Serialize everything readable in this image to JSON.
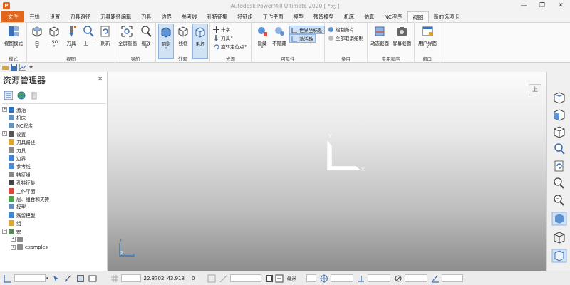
{
  "window": {
    "title": "Autodesk PowerMill Ultimate 2020   [ *无 ]",
    "app_icon_letter": "P",
    "controls": [
      "—",
      "❐",
      "✕"
    ]
  },
  "menu": {
    "tabs": [
      "文件",
      "开始",
      "设置",
      "刀具路径",
      "刀具路径编辑",
      "刀具",
      "边界",
      "参考线",
      "孔特征集",
      "特征组",
      "工作平面",
      "模型",
      "残留模型",
      "机床",
      "仿真",
      "NC程序",
      "视图",
      "新的选项卡"
    ],
    "active": "视图"
  },
  "ribbon": {
    "groups": {
      "mode": "模式",
      "view": "视图",
      "navigate": "导航",
      "appearance": "外观",
      "light": "光源",
      "visibility": "可见性",
      "entity": "条目",
      "utility": "实用程序",
      "window": "窗口"
    },
    "buttons": {
      "view_mode": "视图模式",
      "top": "自",
      "iso": "ISO",
      "tool": "刀具",
      "up": "上一",
      "refresh": "刷新",
      "full_redraw": "全屏重画",
      "zoom": "缩放",
      "shaded": "阴影",
      "wireframe": "线框",
      "blank": "毛坯",
      "crosshair": "十字",
      "tool_small": "刀具",
      "rotate_point": "旋转定位点",
      "hide": "隐藏",
      "unhide": "不隐藏",
      "world_csys": "世界坐标系",
      "active_axis": "激活轴",
      "draw_all": "绘制所有",
      "undraw_all": "全部取消绘制",
      "dynamic_section": "动态截面",
      "screenshot": "屏幕截图",
      "user_interface": "用户界面"
    }
  },
  "explorer": {
    "title": "资源管理器",
    "close": "✕",
    "tree": [
      {
        "label": "激活",
        "expand": "+",
        "color": "#2c6fbf"
      },
      {
        "label": "机床",
        "expand": "",
        "color": "#6a8fb8"
      },
      {
        "label": "NC程序",
        "expand": "",
        "color": "#6a8fb8"
      },
      {
        "label": "设置",
        "expand": "+",
        "color": "#555555"
      },
      {
        "label": "刀具路径",
        "expand": "",
        "color": "#d9a63a"
      },
      {
        "label": "刀具",
        "expand": "",
        "color": "#8a8a8a"
      },
      {
        "label": "边界",
        "expand": "",
        "color": "#3f84d2"
      },
      {
        "label": "参考线",
        "expand": "",
        "color": "#4b8cd6"
      },
      {
        "label": "特征组",
        "expand": "",
        "color": "#8a8a8a"
      },
      {
        "label": "孔特征集",
        "expand": "",
        "color": "#444444"
      },
      {
        "label": "工作平面",
        "expand": "",
        "color": "#d94a3a"
      },
      {
        "label": "层、组合和夹持",
        "expand": "",
        "color": "#49a54a"
      },
      {
        "label": "模型",
        "expand": "",
        "color": "#6a8fb8"
      },
      {
        "label": "残留模型",
        "expand": "",
        "color": "#3f84d2"
      },
      {
        "label": "组",
        "expand": "",
        "color": "#d9a63a"
      },
      {
        "label": "宏",
        "expand": "−",
        "color": "#5a8a5a"
      },
      {
        "label": "-",
        "expand": "+",
        "color": "#8a8a8a",
        "indent": true
      },
      {
        "label": "examples",
        "expand": "+",
        "color": "#8a8a8a",
        "indent": true
      }
    ]
  },
  "viewport": {
    "view_button": "上",
    "axis_x": "X",
    "axis_y": "Y",
    "mini_x": "X",
    "mini_y": "Y",
    "mini_z": "Z"
  },
  "status": {
    "x_value": "22.8702",
    "y_value": "43.918",
    "z_value": "0",
    "unit": "毫米"
  }
}
